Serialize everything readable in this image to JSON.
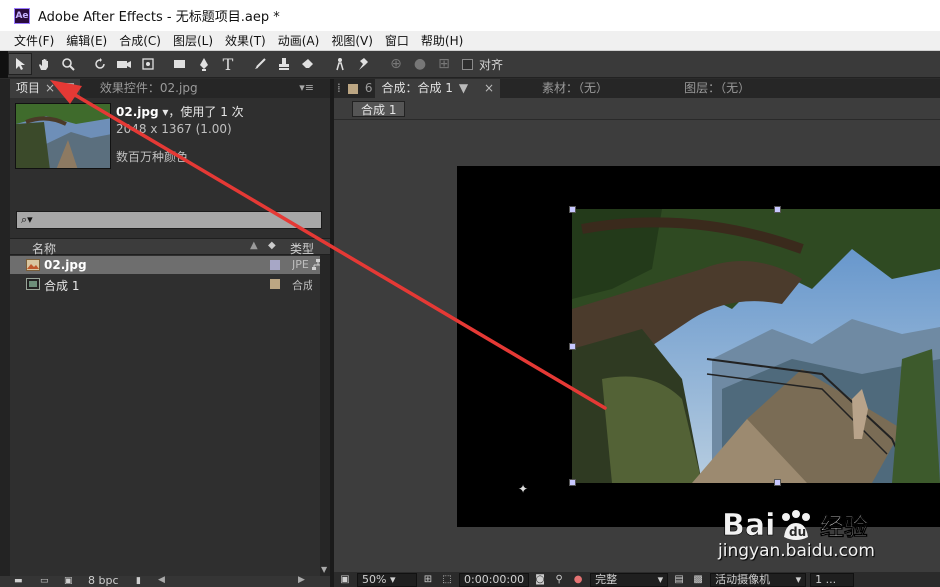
{
  "window": {
    "title": "Adobe After Effects - 无标题项目.aep *",
    "logo_text": "Ae"
  },
  "menu": {
    "items": [
      "文件(F)",
      "编辑(E)",
      "合成(C)",
      "图层(L)",
      "效果(T)",
      "动画(A)",
      "视图(V)",
      "窗口",
      "帮助(H)"
    ]
  },
  "toolbar": {
    "snap_label": "对齐"
  },
  "project_panel": {
    "tab_project": "项目",
    "tab_effects": "效果控件：02.jpg",
    "selected_asset": {
      "name": "02.jpg",
      "usage": "，使用了 1 次",
      "dimensions": "2048 x 1367 (1.00)",
      "color": "数百万种颜色"
    },
    "search_placeholder": "⌕▾",
    "columns": {
      "name": "名称",
      "type": "类型"
    },
    "rows": [
      {
        "name": "02.jpg",
        "type": "JPE",
        "label_color": "#a7a7c6"
      },
      {
        "name": "合成",
        "suffix": "1",
        "type": "合成",
        "label_color": "#bca683"
      }
    ],
    "bottom_bpc": "8 bpc"
  },
  "comp_panel": {
    "tab_comp": "合成：合成 1",
    "tab_footage": "素材：（无）",
    "tab_layer": "图层：（无）",
    "breadcrumb": "合成 1",
    "zoom": "50%",
    "timecode": "0:00:00:00",
    "quality": "完整",
    "camera": "活动摄像机",
    "views": "1 ..."
  },
  "watermark": {
    "brand": "Baidu经验",
    "url": "jingyan.baidu.com"
  },
  "colors": {
    "accent_arrow": "#e53935",
    "selection_handle": "#c8c8ff"
  }
}
